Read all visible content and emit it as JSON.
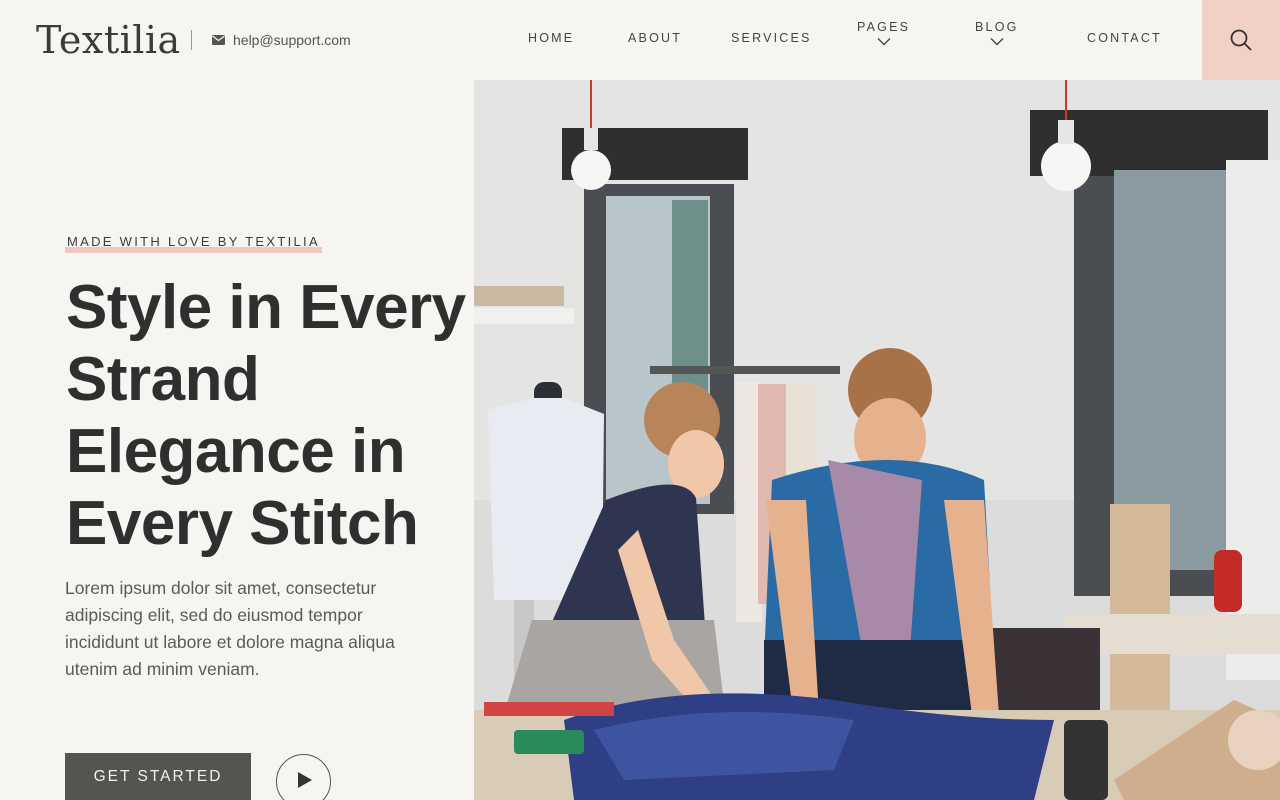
{
  "brand": {
    "logo": "Textilia",
    "email": "help@support.com"
  },
  "nav": {
    "home": "HOME",
    "about": "ABOUT",
    "services": "SERVICES",
    "pages": "PAGES",
    "blog": "BLOG",
    "contact": "CONTACT",
    "active": "HOME"
  },
  "hero": {
    "eyebrow": "MADE WITH LOVE BY TEXTILIA",
    "headline": [
      "Style in Every",
      "Strand",
      "Elegance in",
      "Every Stitch"
    ],
    "body": "Lorem ipsum dolor sit amet, consectetur adipiscing elit, sed do eiusmod tempor incididunt ut labore et dolore magna aliqua utenim ad minim veniam.",
    "cta_label": "GET STARTED"
  },
  "colors": {
    "background": "#f6f5f1",
    "accent": "#f2c6bd",
    "search_bg": "#f2d0c6",
    "button": "#555451",
    "text": "#2f2f2f"
  },
  "icons": {
    "email": "envelope-icon",
    "search": "search-icon",
    "dropdown": "chevron-down-icon",
    "play": "play-icon"
  }
}
